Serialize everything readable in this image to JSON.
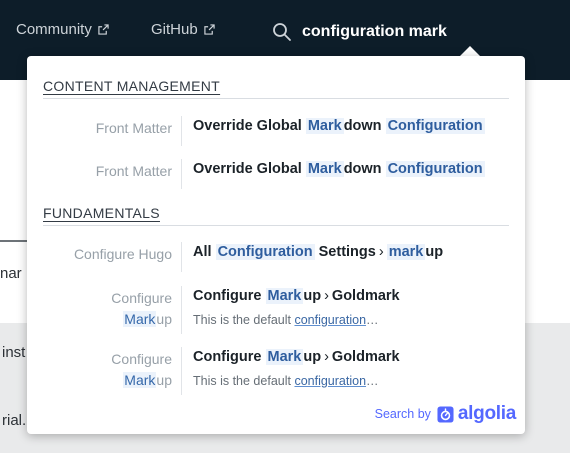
{
  "nav": {
    "links": [
      {
        "label": "Community",
        "icon": "external-link-icon"
      },
      {
        "label": "GitHub",
        "icon": "external-link-icon"
      }
    ],
    "search": {
      "icon": "search-icon",
      "value": "configuration mark"
    }
  },
  "background": {
    "fragments": [
      "nar",
      "inst",
      "rial."
    ]
  },
  "dropdown": {
    "categories": [
      {
        "label": "CONTENT MANAGEMENT",
        "hits": [
          {
            "section": "Front Matter",
            "title": {
              "pre": "Override Global ",
              "hl1": "Mark",
              "mid": "down ",
              "hl2": "Configuration"
            }
          },
          {
            "section": "Front Matter",
            "title": {
              "pre": "Override Global ",
              "hl1": "Mark",
              "mid": "down ",
              "hl2": "Configuration"
            }
          }
        ]
      },
      {
        "label": "FUNDAMENTALS",
        "hits": [
          {
            "section": "Configure Hugo",
            "title": {
              "pre": "All ",
              "hl1": "Configuration",
              "mid": " Settings",
              "sep": "›",
              "hl2": "mark",
              "post": "up"
            }
          },
          {
            "section": {
              "pre": "Configure",
              "hl": "Mark",
              "post": "up"
            },
            "title": {
              "pre": "Configure ",
              "hl1": "Mark",
              "mid": "up",
              "sep": "›",
              "post": "Goldmark"
            },
            "snippet": {
              "pre": "This is the default ",
              "hl": "configuration",
              "post": "…"
            }
          },
          {
            "section": {
              "pre": "Configure",
              "hl": "Mark",
              "post": "up"
            },
            "title": {
              "pre": "Configure ",
              "hl1": "Mark",
              "mid": "up",
              "sep": "›",
              "post": "Goldmark"
            },
            "snippet": {
              "pre": "This is the default ",
              "hl": "configuration",
              "post": "…"
            }
          }
        ]
      }
    ],
    "footer": {
      "search_by": "Search by",
      "brand": "algolia",
      "icon": "algolia-logo-icon"
    }
  },
  "colors": {
    "topbar": "#0d1d29",
    "highlight_bg": "#ebf2fb",
    "highlight_text": "#2e5d9e",
    "algolia": "#5468ff"
  }
}
